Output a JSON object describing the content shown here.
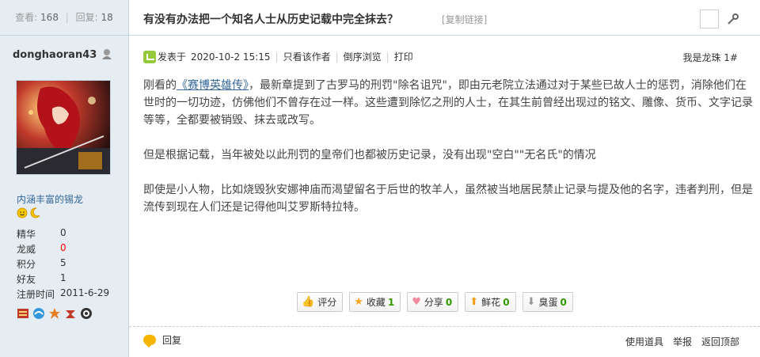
{
  "stats_bar": {
    "views_label": "查看:",
    "views": "168",
    "replies_label": "回复:",
    "replies": "18"
  },
  "author": {
    "name": "donghaoran43",
    "rank": "内涵丰富的锡龙",
    "stats": [
      {
        "label": "精华",
        "value": "0"
      },
      {
        "label": "龙威",
        "value": "0"
      },
      {
        "label": "积分",
        "value": "5"
      },
      {
        "label": "好友",
        "value": "1"
      },
      {
        "label": "注册时间",
        "value": "2011-6-29"
      }
    ]
  },
  "thread": {
    "title": "有没有办法把一个知名人士从历史记载中完全抹去？",
    "copy_link": "[复制链接]"
  },
  "post": {
    "posted_prefix": "发表于",
    "posted_time": "2020-10-2 15:15",
    "only_author": "只看该作者",
    "reverse_view": "倒序浏览",
    "print": "打印",
    "floor": "我是龙珠 1#",
    "para1_before": "刚看的",
    "para1_link": "《赛博英雄传》",
    "para1_after": "，最新章提到了古罗马的刑罚\"除名诅咒\"，即由元老院立法通过对于某些已故人士的惩罚，消除他们在世时的一切功迹，仿佛他们不曾存在过一样。这些遭到除忆之刑的人士，在其生前曾经出现过的铭文、雕像、货币、文字记录等等，全都要被销毁、抹去或改写。",
    "para2": "但是根据记载，当年被处以此刑罚的皇帝们也都被历史记录，没有出现\"空白\"\"无名氏\"的情况",
    "para3": "即使是小人物，比如烧毁狄安娜神庙而渴望留名于后世的牧羊人，虽然被当地居民禁止记录与提及他的名字，违者判刑，但是流传到现在人们还是记得他叫艾罗斯特拉特。"
  },
  "actions": {
    "rate": "评分",
    "favorite": "收藏",
    "favorite_count": "1",
    "share": "分享",
    "share_count": "0",
    "flower": "鲜花",
    "flower_count": "0",
    "egg": "臭蛋",
    "egg_count": "0"
  },
  "footer": {
    "reply": "回复",
    "use_tool": "使用道具",
    "report": "举报",
    "back_top": "返回顶部"
  }
}
